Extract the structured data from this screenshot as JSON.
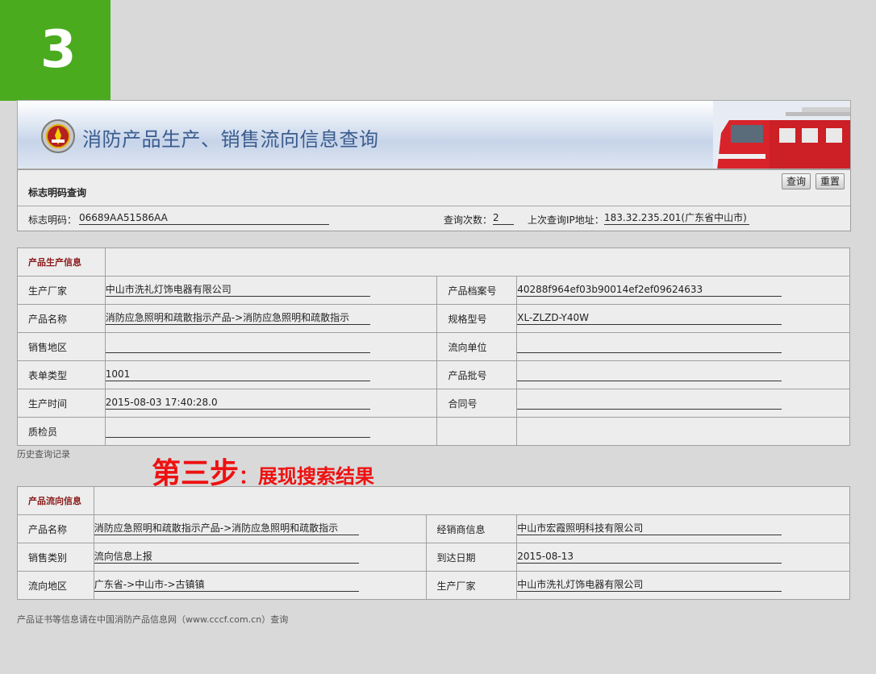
{
  "step_number": "3",
  "banner": {
    "title": "消防产品生产、销售流向信息查询"
  },
  "query": {
    "panel_title": "标志明码查询",
    "query_button": "查询",
    "reset_button": "重置",
    "code_label": "标志明码：",
    "code_value": "06689AA51586AA",
    "count_label": "查询次数：",
    "count_value": "2",
    "ip_label": "上次查询IP地址：",
    "ip_value": "183.32.235.201(广东省中山市)"
  },
  "production": {
    "section_title": "产品生产信息",
    "manufacturer_label": "生产厂家",
    "manufacturer": "中山市洗礼灯饰电器有限公司",
    "archive_label": "产品档案号",
    "archive": "40288f964ef03b90014ef2ef09624633",
    "name_label": "产品名称",
    "name": "消防应急照明和疏散指示产品->消防应急照明和疏散指示",
    "model_label": "规格型号",
    "model": "XL-ZLZD-Y40W",
    "region_label": "销售地区",
    "region": "",
    "unit_label": "流向单位",
    "unit": "",
    "form_label": "表单类型",
    "form": "1001",
    "batch_label": "产品批号",
    "batch": "",
    "time_label": "生产时间",
    "time": "2015-08-03 17:40:28.0",
    "contract_label": "合同号",
    "contract": "",
    "inspector_label": "质检员",
    "inspector": ""
  },
  "history_link": "历史查询记录",
  "step_caption": {
    "main": "第三步",
    "colon": "：",
    "detail": "展现搜索结果"
  },
  "flow": {
    "section_title": "产品流向信息",
    "name_label": "产品名称",
    "name": "消防应急照明和疏散指示产品->消防应急照明和疏散指示",
    "dealer_label": "经销商信息",
    "dealer": "中山市宏霞照明科技有限公司",
    "category_label": "销售类别",
    "category": "流向信息上报",
    "arrival_label": "到达日期",
    "arrival": "2015-08-13",
    "area_label": "流向地区",
    "area": "广东省->中山市->古镇镇",
    "manufacturer_label": "生产厂家",
    "manufacturer": "中山市洗礼灯饰电器有限公司"
  },
  "footer": "产品证书等信息请在中国消防产品信息网（www.cccf.com.cn）查询",
  "colors": {
    "badge": "#4aab1f",
    "section_title": "#8b1a1a",
    "caption": "#ee1111"
  }
}
